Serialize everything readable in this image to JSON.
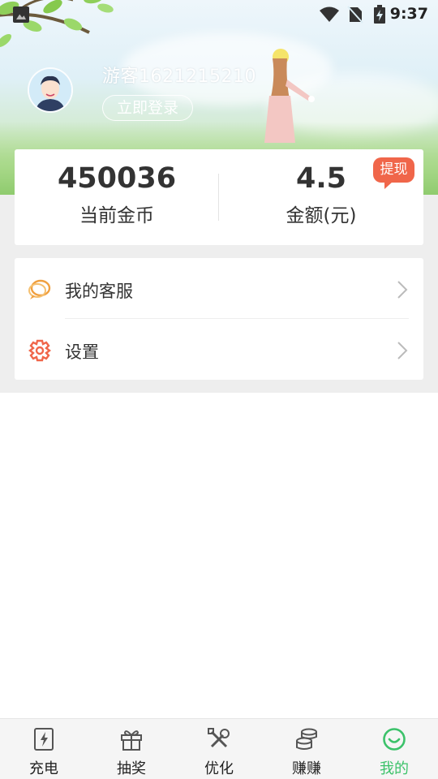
{
  "status_bar": {
    "time": "9:37"
  },
  "profile": {
    "username": "游客1621215210",
    "login_button": "立即登录"
  },
  "stats": {
    "coins_value": "450036",
    "coins_label": "当前金币",
    "amount_value": "4.5",
    "amount_label": "金额(元)",
    "withdraw_label": "提现"
  },
  "menu": {
    "items": [
      {
        "label": "我的客服",
        "icon": "chat-bubble-icon"
      },
      {
        "label": "设置",
        "icon": "gear-icon"
      }
    ]
  },
  "bottom_nav": {
    "active_color": "#3cc26a",
    "tabs": [
      {
        "label": "充电",
        "icon": "charge-icon"
      },
      {
        "label": "抽奖",
        "icon": "gift-icon"
      },
      {
        "label": "优化",
        "icon": "tools-icon"
      },
      {
        "label": "赚赚",
        "icon": "coins-icon"
      },
      {
        "label": "我的",
        "icon": "smile-icon",
        "active": true
      }
    ]
  },
  "colors": {
    "withdraw_badge": "#f0664a",
    "service_icon": "#f0a040",
    "settings_icon": "#f0664a"
  }
}
